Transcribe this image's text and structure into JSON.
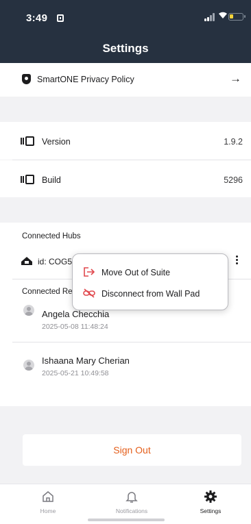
{
  "status_bar": {
    "time": "3:49"
  },
  "header": {
    "title": "Settings"
  },
  "privacy": {
    "label": "SmartONE Privacy Policy"
  },
  "version": {
    "label": "Version",
    "value": "1.9.2"
  },
  "build": {
    "label": "Build",
    "value": "5296"
  },
  "connected_hubs": {
    "heading": "Connected Hubs",
    "hub_id": "id: COG5"
  },
  "connected_residents": {
    "heading": "Connected Re",
    "residents": [
      {
        "name": "Angela Checchia",
        "time": "2025-05-08 11:48:24"
      },
      {
        "name": "Ishaana Mary Cherian",
        "time": "2025-05-21 10:49:58"
      }
    ]
  },
  "popup_menu": {
    "items": [
      {
        "label": "Move Out of Suite",
        "icon": "move-out-icon"
      },
      {
        "label": "Disconnect from Wall Pad",
        "icon": "unlink-icon"
      }
    ]
  },
  "sign_out": {
    "label": "Sign Out"
  },
  "tabbar": {
    "tabs": [
      {
        "label": "Home",
        "icon": "home-icon"
      },
      {
        "label": "Notifications",
        "icon": "bell-icon"
      },
      {
        "label": "Settings",
        "icon": "gear-icon"
      }
    ],
    "active": "Settings"
  },
  "colors": {
    "header_bg": "#263140",
    "accent": "#e45e1a",
    "menu_icon": "#e0474c"
  }
}
